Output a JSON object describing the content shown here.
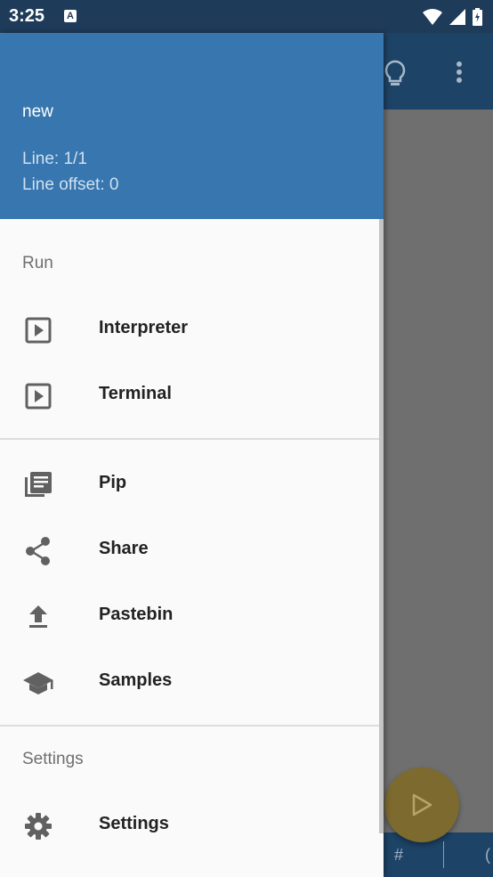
{
  "status_bar": {
    "time": "3:25",
    "notification_letter": "A"
  },
  "drawer": {
    "header": {
      "file_name": "new",
      "line": "Line: 1/1",
      "line_offset": "Line offset: 0"
    },
    "sections": {
      "run_title": "Run",
      "settings_title": "Settings"
    },
    "items": {
      "interpreter": "Interpreter",
      "terminal": "Terminal",
      "pip": "Pip",
      "share": "Share",
      "pastebin": "Pastebin",
      "samples": "Samples",
      "settings": "Settings"
    }
  },
  "background_app": {
    "bottom_bar": {
      "hash": "#",
      "paren": "("
    }
  },
  "colors": {
    "drawer_header": "#3776ae",
    "status_bar": "#1f3b5a",
    "app_toolbar": "#1d4366",
    "fab": "#7d6a2e",
    "icon_gray": "#616161"
  }
}
